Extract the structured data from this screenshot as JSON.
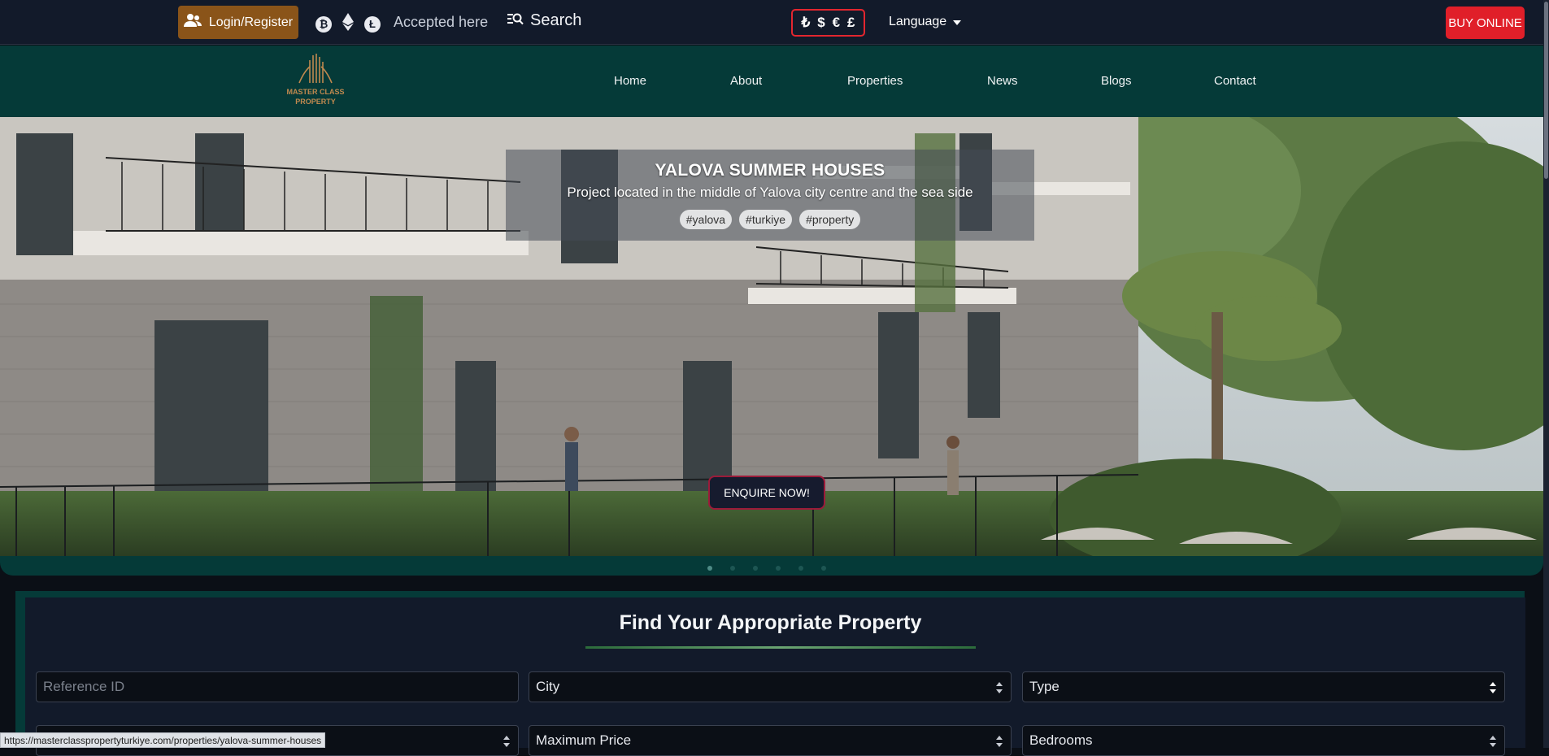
{
  "topbar": {
    "login_label": "Login/Register",
    "crypto_icons": [
      "bitcoin-icon",
      "ethereum-icon",
      "litecoin-icon"
    ],
    "accepted_text": "Accepted here",
    "search_label": "Search",
    "currencies": [
      "₺",
      "$",
      "€",
      "£"
    ],
    "language_label": "Language",
    "buy_label": "BUY ONLINE"
  },
  "logo": {
    "line1": "MASTER CLASS",
    "line2": "PROPERTY"
  },
  "nav": {
    "items": [
      "Home",
      "About",
      "Properties",
      "News",
      "Blogs",
      "Contact"
    ]
  },
  "hero": {
    "title": "YALOVA SUMMER HOUSES",
    "subtitle": "Project located in the middle of Yalova city centre and the sea side",
    "tags": [
      "#yalova",
      "#turkiye",
      "#property"
    ],
    "cta": "ENQUIRE NOW!",
    "slides": 6,
    "active_slide": 1
  },
  "finder": {
    "title": "Find Your Appropriate Property",
    "reference_placeholder": "Reference ID",
    "city": "City",
    "type": "Type",
    "max_price": "Maximum Price",
    "bedrooms": "Bedrooms"
  },
  "status_url": "https://masterclasspropertyturkiye.com/properties/yalova-summer-houses",
  "colors": {
    "accent_red": "#e01f29",
    "brand_green": "#053a38",
    "login_bronze": "#8a5419",
    "dark_bg": "#121a2a"
  }
}
